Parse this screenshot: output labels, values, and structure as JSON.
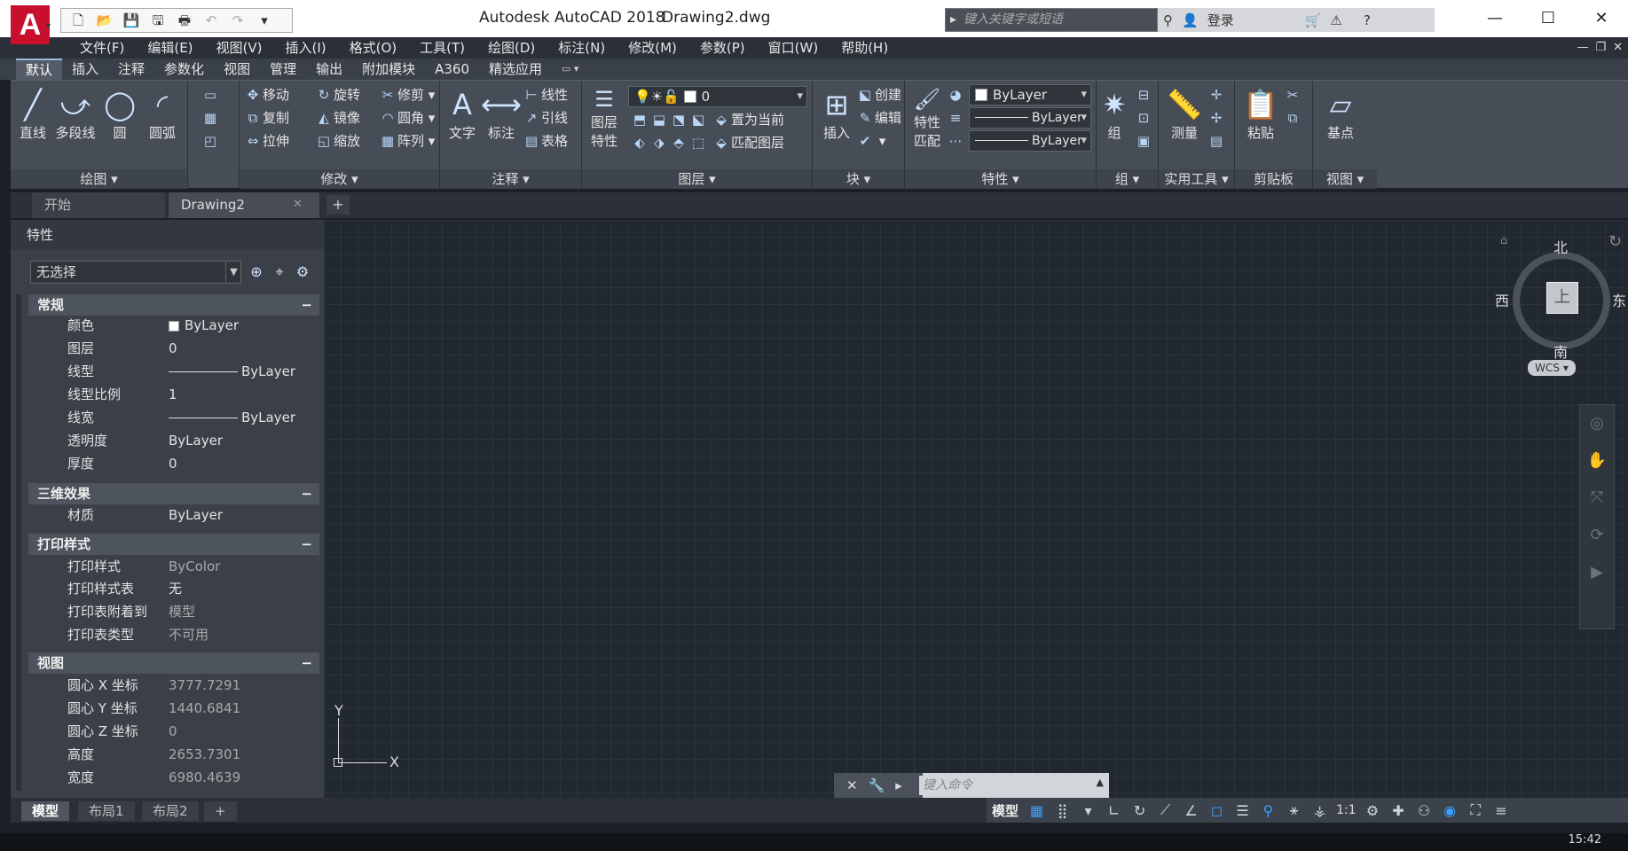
{
  "app": {
    "logo": "A",
    "title": "Autodesk AutoCAD 2018",
    "file": "Drawing2.dwg",
    "search_placeholder": "键入关键字或短语",
    "login": "登录",
    "help": "?",
    "qat_icons": [
      "new-icon",
      "open-icon",
      "save-icon",
      "saveas-icon",
      "print-icon",
      "undo-icon",
      "redo-icon",
      "qat-menu-icon"
    ]
  },
  "menu": [
    "文件(F)",
    "编辑(E)",
    "视图(V)",
    "插入(I)",
    "格式(O)",
    "工具(T)",
    "绘图(D)",
    "标注(N)",
    "修改(M)",
    "参数(P)",
    "窗口(W)",
    "帮助(H)"
  ],
  "ribbon_tabs": [
    "默认",
    "插入",
    "注释",
    "参数化",
    "视图",
    "管理",
    "输出",
    "附加模块",
    "A360",
    "精选应用"
  ],
  "ribbon": {
    "draw": {
      "title": "绘图",
      "line": "直线",
      "polyline": "多段线",
      "circle": "圆",
      "arc": "圆弧"
    },
    "modify": {
      "title": "修改",
      "move": "移动",
      "rotate": "旋转",
      "trim": "修剪",
      "copy": "复制",
      "mirror": "镜像",
      "fillet": "圆角",
      "stretch": "拉伸",
      "scale": "缩放",
      "array": "阵列"
    },
    "annotation": {
      "title": "注释",
      "text": "文字",
      "dimension": "标注",
      "linear": "线性",
      "leader": "引线",
      "table": "表格"
    },
    "layers": {
      "title": "图层",
      "layer_props_1": "图层",
      "layer_props_2": "特性",
      "current_layer": "0",
      "set_current": "置为当前",
      "match_layer": "匹配图层"
    },
    "block": {
      "title": "块",
      "insert": "插入",
      "create": "创建",
      "edit": "编辑"
    },
    "properties": {
      "title": "特性",
      "match_1": "特性",
      "match_2": "匹配",
      "color": "ByLayer",
      "linetype": "ByLayer",
      "lineweight": "ByLayer"
    },
    "groups": {
      "title": "组",
      "group": "组"
    },
    "utilities": {
      "title": "实用工具",
      "measure": "测量"
    },
    "clipboard": {
      "title": "剪贴板",
      "paste": "粘贴"
    },
    "view": {
      "title": "视图",
      "base": "基点"
    }
  },
  "doc_tabs": {
    "start": "开始",
    "drawing": "Drawing2",
    "add": "+"
  },
  "properties": {
    "title": "特性",
    "selection": "无选择",
    "sections": {
      "general": {
        "title": "常规",
        "rows": [
          {
            "k": "颜色",
            "v": "ByLayer"
          },
          {
            "k": "图层",
            "v": "0"
          },
          {
            "k": "线型",
            "v": "ByLayer"
          },
          {
            "k": "线型比例",
            "v": "1"
          },
          {
            "k": "线宽",
            "v": "ByLayer"
          },
          {
            "k": "透明度",
            "v": "ByLayer"
          },
          {
            "k": "厚度",
            "v": "0"
          }
        ]
      },
      "effects3d": {
        "title": "三维效果",
        "rows": [
          {
            "k": "材质",
            "v": "ByLayer"
          }
        ]
      },
      "plot": {
        "title": "打印样式",
        "rows": [
          {
            "k": "打印样式",
            "v": "ByColor"
          },
          {
            "k": "打印样式表",
            "v": "无"
          },
          {
            "k": "打印表附着到",
            "v": "模型"
          },
          {
            "k": "打印表类型",
            "v": "不可用"
          }
        ]
      },
      "view": {
        "title": "视图",
        "rows": [
          {
            "k": "圆心 X 坐标",
            "v": "3777.7291"
          },
          {
            "k": "圆心 Y 坐标",
            "v": "1440.6841"
          },
          {
            "k": "圆心 Z 坐标",
            "v": "0"
          },
          {
            "k": "高度",
            "v": "2653.7301"
          },
          {
            "k": "宽度",
            "v": "6980.4639"
          }
        ]
      }
    }
  },
  "viewcube": {
    "north": "北",
    "south": "南",
    "east": "东",
    "west": "西",
    "top": "上",
    "wcs": "WCS"
  },
  "ucs": {
    "x": "X",
    "y": "Y"
  },
  "command": {
    "placeholder": "键入命令"
  },
  "layout_tabs": [
    "模型",
    "布局1",
    "布局2",
    "+"
  ],
  "status": {
    "model": "模型",
    "scale": "1:1"
  },
  "clock": "15:42"
}
